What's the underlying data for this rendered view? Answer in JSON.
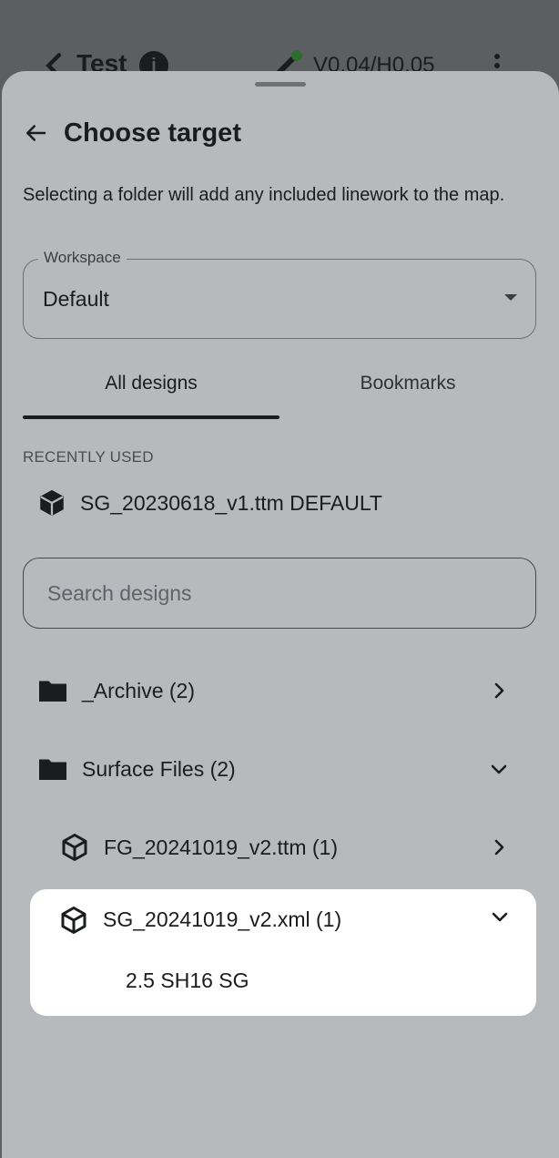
{
  "appbar": {
    "title": "Test",
    "info_glyph": "i",
    "accuracy": "V0.04/H0.05",
    "back_icon": "chevron-left-icon",
    "gps_icon": "satellite-icon",
    "menu_icon": "more-vert-icon"
  },
  "sheet": {
    "back_icon": "arrow-left-icon",
    "title": "Choose target",
    "hint": "Selecting a folder will add any included linework to the map."
  },
  "workspace": {
    "label": "Workspace",
    "value": "Default"
  },
  "tabs": [
    {
      "label": "All designs",
      "active": true
    },
    {
      "label": "Bookmarks",
      "active": false
    }
  ],
  "recent": {
    "section_label": "RECENTLY USED",
    "item": "SG_20230618_v1.ttm DEFAULT"
  },
  "search": {
    "placeholder": "Search designs"
  },
  "tree": {
    "archive": "_Archive (2)",
    "surface": "Surface Files (2)",
    "fg": "FG_20241019_v2.ttm (1)",
    "sg": "SG_20241019_v2.xml (1)",
    "sg_child": "2.5 SH16 SG"
  },
  "colors": {
    "scrim": "#5f6264",
    "sheet": "#b7babd",
    "card": "#ffffff",
    "text": "#1b1c1e"
  }
}
